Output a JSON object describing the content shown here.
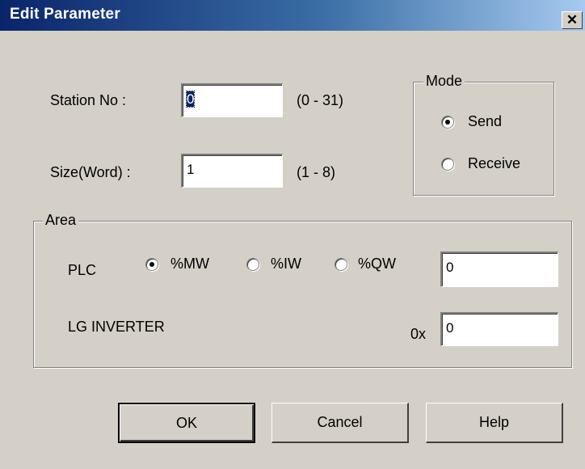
{
  "window": {
    "title": "Edit Parameter",
    "close_glyph": "✕"
  },
  "station": {
    "label": "Station No :",
    "value": "0",
    "range": "(0 - 31)"
  },
  "size": {
    "label": "Size(Word) :",
    "value": "1",
    "range": "(1 - 8)"
  },
  "mode": {
    "title": "Mode",
    "options": [
      {
        "label": "Send",
        "selected": true
      },
      {
        "label": "Receive",
        "selected": false
      }
    ]
  },
  "area": {
    "title": "Area",
    "plc_label": "PLC",
    "plc_options": [
      {
        "label": "%MW",
        "selected": true
      },
      {
        "label": "%IW",
        "selected": false
      },
      {
        "label": "%QW",
        "selected": false
      }
    ],
    "plc_value": "0",
    "inverter_label": "LG INVERTER",
    "hex_prefix": "0x",
    "inverter_value": "0"
  },
  "buttons": {
    "ok": "OK",
    "cancel": "Cancel",
    "help": "Help"
  }
}
